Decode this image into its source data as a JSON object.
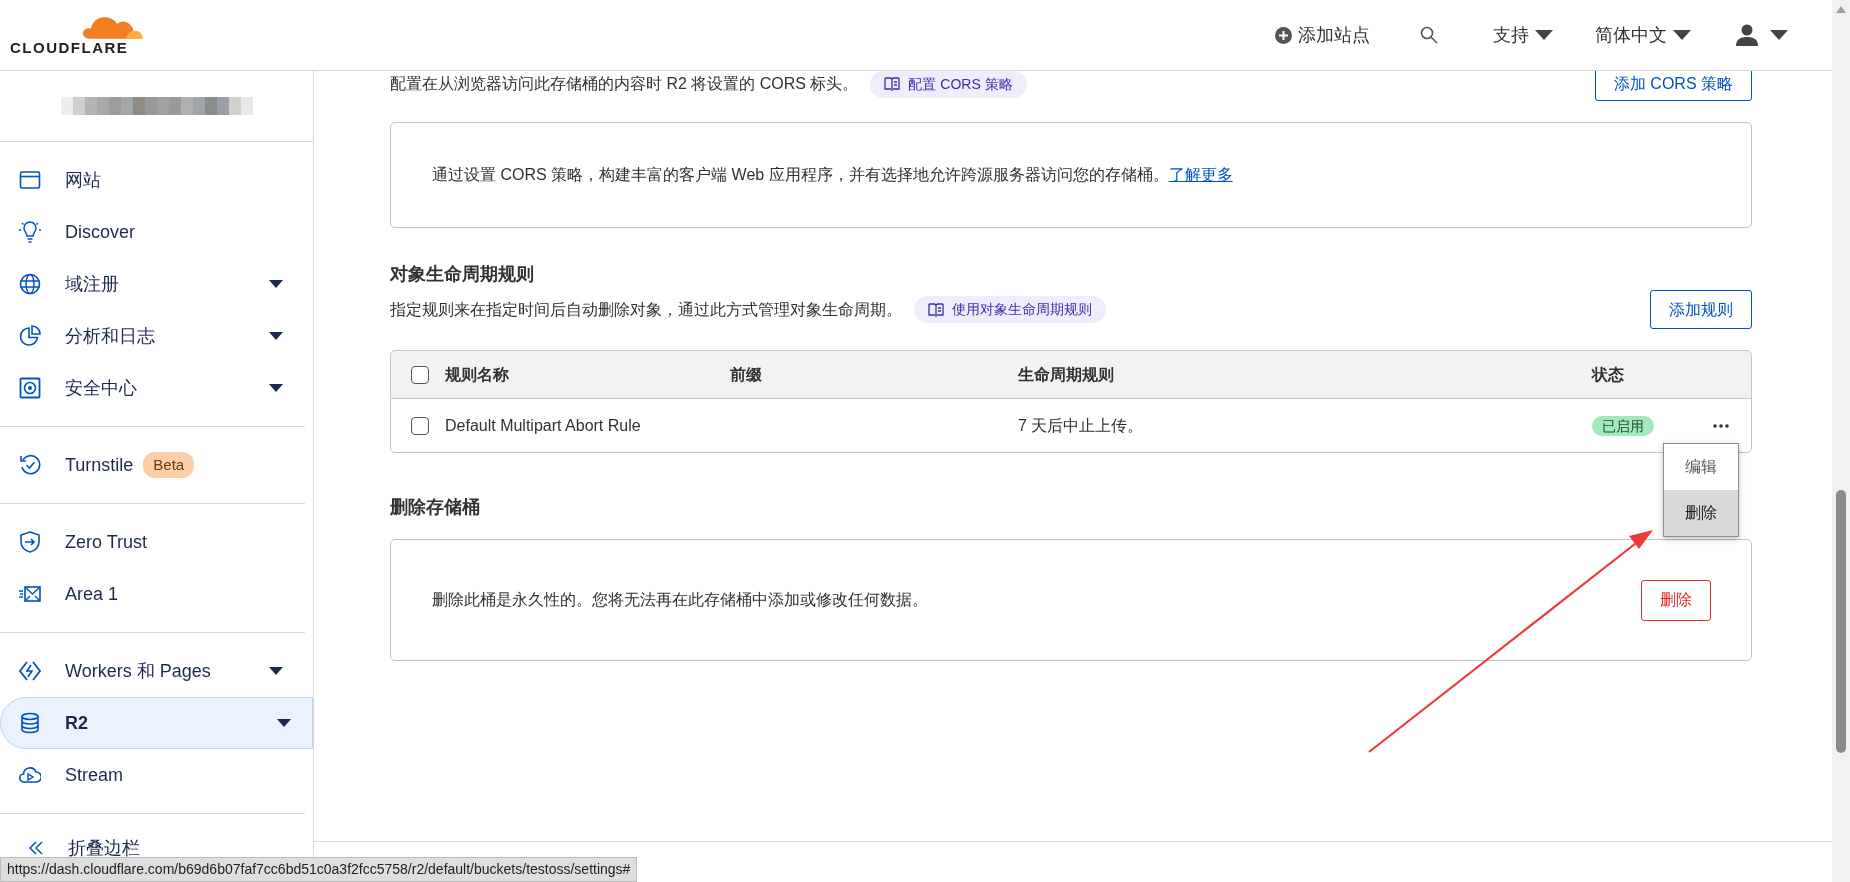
{
  "header": {
    "logo": "CLOUDFLARE",
    "add_site": "添加站点",
    "support": "支持",
    "language": "简体中文"
  },
  "sidebar": {
    "groups": [
      [
        {
          "label": "网站",
          "expandable": false,
          "selected": false
        },
        {
          "label": "Discover",
          "expandable": false,
          "selected": false
        },
        {
          "label": "域注册",
          "expandable": true,
          "selected": false
        },
        {
          "label": "分析和日志",
          "expandable": true,
          "selected": false
        },
        {
          "label": "安全中心",
          "expandable": true,
          "selected": false
        }
      ],
      [
        {
          "label": "Turnstile",
          "badge": "Beta",
          "expandable": false,
          "selected": false
        }
      ],
      [
        {
          "label": "Zero Trust",
          "expandable": false,
          "selected": false
        },
        {
          "label": "Area 1",
          "expandable": false,
          "selected": false
        }
      ],
      [
        {
          "label": "Workers 和 Pages",
          "expandable": true,
          "selected": false
        },
        {
          "label": "R2",
          "expandable": true,
          "selected": true
        },
        {
          "label": "Stream",
          "expandable": false,
          "selected": false
        }
      ]
    ],
    "collapse": "折叠边栏"
  },
  "cors": {
    "description": "配置在从浏览器访问此存储桶的内容时 R2 将设置的 CORS 标头。",
    "doc_link": "配置 CORS 策略",
    "add_button": "添加 CORS 策略",
    "empty_text": "通过设置 CORS 策略，构建丰富的客户端 Web 应用程序，并有选择地允许跨源服务器访问您的存储桶。",
    "learn_more": "了解更多"
  },
  "lifecycle": {
    "title": "对象生命周期规则",
    "description": "指定规则来在指定时间后自动删除对象，通过此方式管理对象生命周期。",
    "doc_link": "使用对象生命周期规则",
    "add_button": "添加规则",
    "table": {
      "all_checked": false,
      "columns": [
        "规则名称",
        "前缀",
        "生命周期规则",
        "状态"
      ],
      "rows": [
        {
          "checked": false,
          "name": "Default Multipart Abort Rule",
          "rule": "7 天后中止上传。",
          "status": "已启用",
          "color": "#a6e8bd",
          "menu_open": true
        }
      ],
      "row_menu": [
        {
          "label": "编辑",
          "selected": false
        },
        {
          "label": "删除",
          "selected": true
        }
      ]
    }
  },
  "delete_bucket": {
    "title": "删除存储桶",
    "text": "删除此桶是永久性的。您将无法再在此存储桶中添加或修改任何数据。",
    "button": "删除"
  },
  "annotations": [
    {
      "kind": "arrow"
    }
  ],
  "status_url": "https://dash.cloudflare.com/b69d6b07faf7cc6bd51c0a3f2fcc5758/r2/default/buckets/testoss/settings#"
}
